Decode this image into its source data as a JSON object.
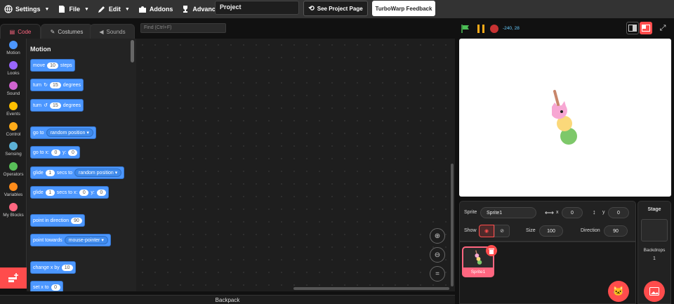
{
  "menubar": {
    "settings": "Settings",
    "file": "File",
    "edit": "Edit",
    "addons": "Addons",
    "advanced": "Advanced",
    "project_title": "Project",
    "see_project": "See Project Page",
    "feedback": "TurboWarp Feedback"
  },
  "tabs": {
    "code": "Code",
    "costumes": "Costumes",
    "sounds": "Sounds"
  },
  "find_placeholder": "Find (Ctrl+F)",
  "categories": [
    {
      "label": "Motion",
      "color": "#4c97ff"
    },
    {
      "label": "Looks",
      "color": "#9966ff"
    },
    {
      "label": "Sound",
      "color": "#cf63cf"
    },
    {
      "label": "Events",
      "color": "#ffbf00"
    },
    {
      "label": "Control",
      "color": "#ffab19"
    },
    {
      "label": "Sensing",
      "color": "#5cb1d6"
    },
    {
      "label": "Operators",
      "color": "#59c059"
    },
    {
      "label": "Variables",
      "color": "#ff8c1a"
    },
    {
      "label": "My Blocks",
      "color": "#ff6680"
    }
  ],
  "palette": {
    "title": "Motion",
    "move": {
      "a": "move",
      "v": "10",
      "b": "steps"
    },
    "turn_right": {
      "a": "turn",
      "v": "15",
      "b": "degrees"
    },
    "turn_left": {
      "a": "turn",
      "v": "15",
      "b": "degrees"
    },
    "goto": {
      "a": "go to",
      "d": "random position"
    },
    "goto_xy": {
      "a": "go to x:",
      "x": "0",
      "b": "y:",
      "y": "0"
    },
    "glide_to": {
      "a": "glide",
      "v": "1",
      "b": "secs to",
      "d": "random position"
    },
    "glide_xy": {
      "a": "glide",
      "v": "1",
      "b": "secs to x:",
      "x": "0",
      "c": "y:",
      "y": "0"
    },
    "point_dir": {
      "a": "point in direction",
      "v": "90"
    },
    "point_towards": {
      "a": "point towards",
      "d": "mouse-pointer"
    },
    "change_x": {
      "a": "change x by",
      "v": "10"
    },
    "set_x": {
      "a": "set x to",
      "v": "0"
    }
  },
  "stage_header": {
    "coords": "-240, 28"
  },
  "sprite_info": {
    "sprite_label": "Sprite",
    "sprite_name": "Sprite1",
    "x_label": "x",
    "x": "0",
    "y_label": "y",
    "y": "0",
    "show_label": "Show",
    "size_label": "Size",
    "size": "100",
    "direction_label": "Direction",
    "direction": "90"
  },
  "sprite_card": {
    "name": "Sprite1"
  },
  "stage_panel": {
    "title": "Stage",
    "backdrops_label": "Backdrops",
    "backdrops_count": "1"
  },
  "backpack": "Backpack",
  "colors": {
    "accent": "#ff6680",
    "motion": "#4c97ff",
    "danger": "#ff4c4c"
  }
}
